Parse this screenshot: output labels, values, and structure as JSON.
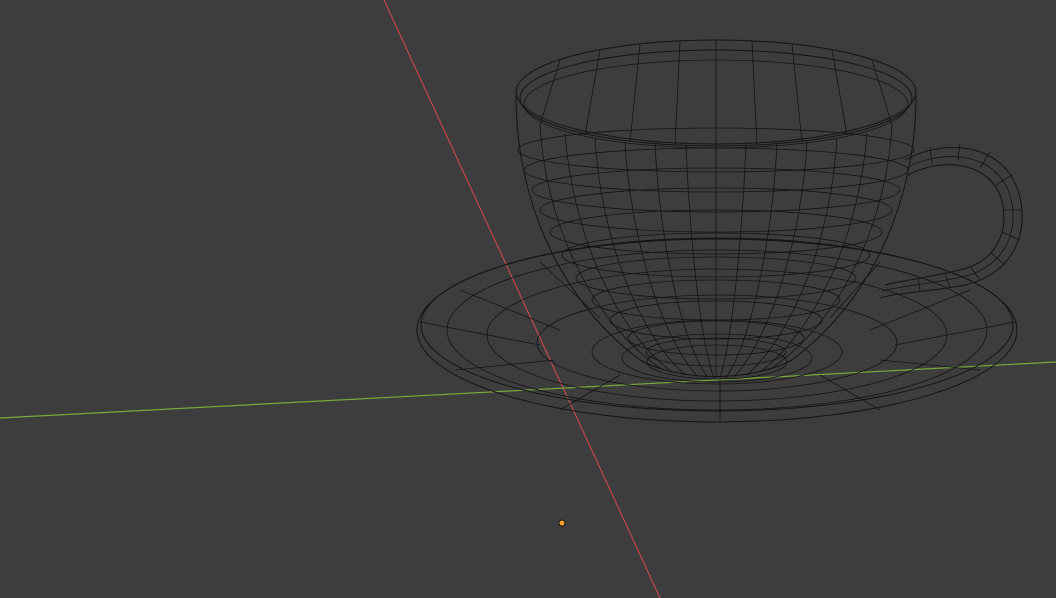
{
  "viewport": {
    "background_color": "#3d3d3d",
    "shading_mode": "wireframe",
    "object_name": "teacup-with-saucer",
    "wire_color": "#141414"
  },
  "axes": {
    "x_axis_color": "#c0484f",
    "y_axis_color": "#7aa83d"
  },
  "origin_marker": {
    "color": "#f0a030",
    "icon": "object-origin-icon"
  }
}
